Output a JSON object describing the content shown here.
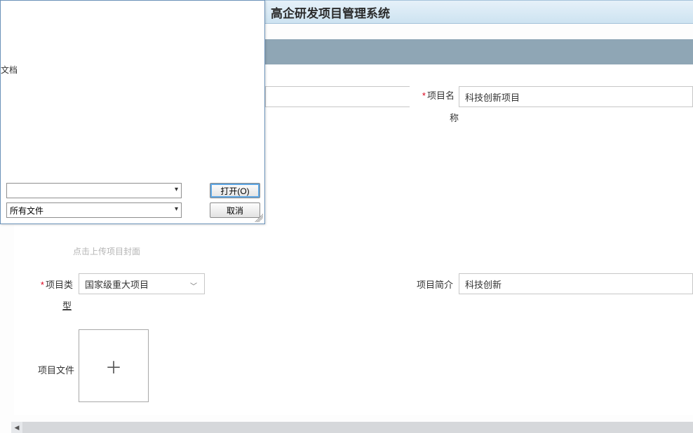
{
  "app": {
    "title": "高企研发项目管理系统"
  },
  "file_dialog": {
    "sidebar_label": "文档",
    "filename_value": "",
    "filter_value": "所有文件",
    "open_button": "打开(O)",
    "cancel_button": "取消"
  },
  "form": {
    "project_name": {
      "label_top": "项目名",
      "label_bottom": "称",
      "value": "科技创新项目"
    },
    "upload_cover_hint": "点击上传项目封面",
    "project_type": {
      "label_top": "项目类",
      "label_bottom": "型",
      "value": "国家级重大项目"
    },
    "project_intro": {
      "label": "项目简介",
      "value": "科技创新"
    },
    "project_file": {
      "label": "项目文件"
    }
  }
}
